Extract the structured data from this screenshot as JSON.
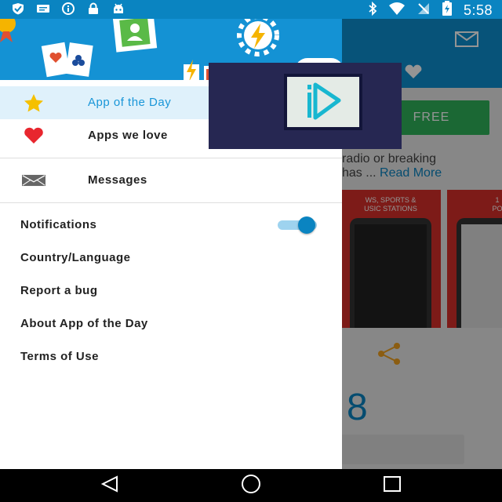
{
  "status_bar": {
    "time": "5:58",
    "left_icons": [
      "shield-icon",
      "message-icon",
      "info-icon",
      "lock-icon",
      "android-icon"
    ],
    "right_icons": [
      "bluetooth-icon",
      "wifi-icon",
      "no-signal-icon",
      "battery-icon"
    ]
  },
  "background_app": {
    "free_button": "FREE",
    "description_line1": "radio or breaking",
    "description_line2": "has ...",
    "read_more": "Read More",
    "screenshot1_caption_line1": "WS, SPORTS &",
    "screenshot1_caption_line2": "USIC STATIONS",
    "screenshot2_caption_line1": "1",
    "screenshot2_caption_line2": "PO",
    "big_number": "8"
  },
  "drawer": {
    "items": [
      {
        "label": "App of the Day",
        "icon": "star-icon",
        "active": true
      },
      {
        "label": "Apps we love",
        "icon": "heart-icon",
        "active": false
      }
    ],
    "messages": {
      "label": "Messages",
      "icon": "envelope-icon"
    },
    "settings": {
      "notifications": {
        "label": "Notifications",
        "enabled": true
      },
      "country_language": "Country/Language",
      "report_bug": "Report a bug",
      "about": "About App of the Day",
      "terms": "Terms of Use"
    }
  },
  "colors": {
    "accent": "#0a84c1",
    "drawer_header": "#1492d4",
    "active_bg": "#dff1fb",
    "free_green": "#2fb45b"
  },
  "nav_bar": {
    "buttons": [
      "back-icon",
      "home-icon",
      "recents-icon"
    ]
  }
}
